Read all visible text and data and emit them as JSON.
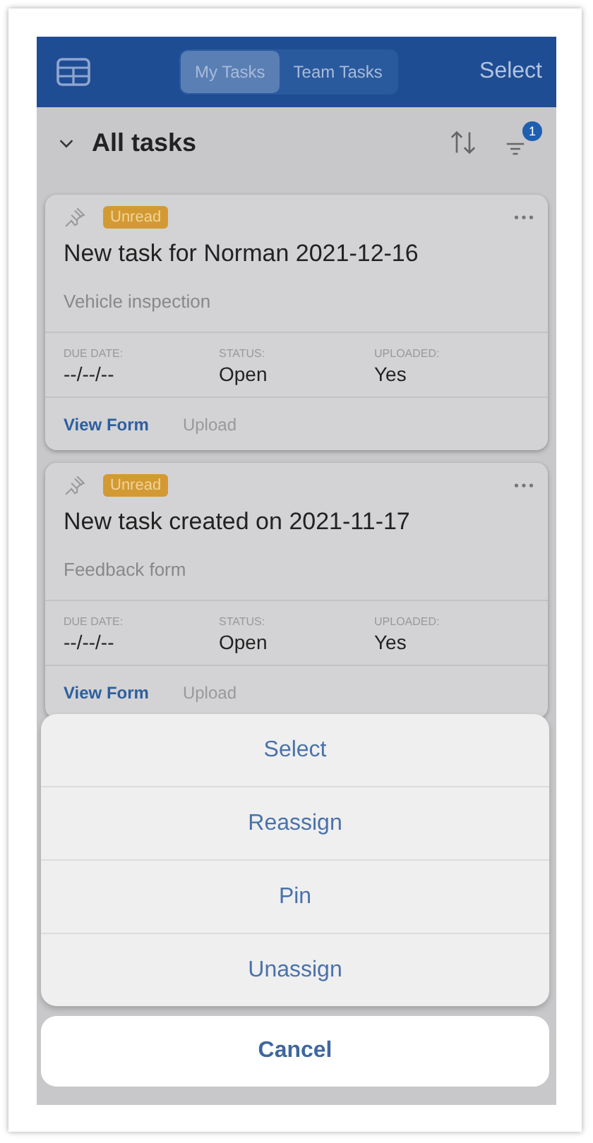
{
  "header": {
    "tabs": [
      {
        "label": "My Tasks",
        "selected": true
      },
      {
        "label": "Team Tasks",
        "selected": false
      }
    ],
    "select": "Select"
  },
  "list_header": {
    "title": "All tasks",
    "expanded": true,
    "filter_count": "1"
  },
  "tasks": [
    {
      "badge": "Unread",
      "title": "New task for Norman 2021-12-16",
      "form": "Vehicle inspection",
      "fields": [
        {
          "label": "DUE DATE:",
          "value": "--/--/--"
        },
        {
          "label": "STATUS:",
          "value": "Open"
        },
        {
          "label": "UPLOADED:",
          "value": "Yes"
        }
      ],
      "actions": [
        {
          "label": "View Form",
          "disabled": false
        },
        {
          "label": "Upload",
          "disabled": true
        }
      ]
    },
    {
      "badge": "Unread",
      "title": "New task created on 2021-11-17",
      "form": "Feedback form",
      "fields": [
        {
          "label": "DUE DATE:",
          "value": "--/--/--"
        },
        {
          "label": "STATUS:",
          "value": "Open"
        },
        {
          "label": "UPLOADED:",
          "value": "Yes"
        }
      ],
      "actions": [
        {
          "label": "View Form",
          "disabled": false
        },
        {
          "label": "Upload",
          "disabled": true
        }
      ]
    }
  ],
  "action_sheet": {
    "items": [
      "Select",
      "Reassign",
      "Pin",
      "Unassign"
    ],
    "cancel": "Cancel"
  }
}
